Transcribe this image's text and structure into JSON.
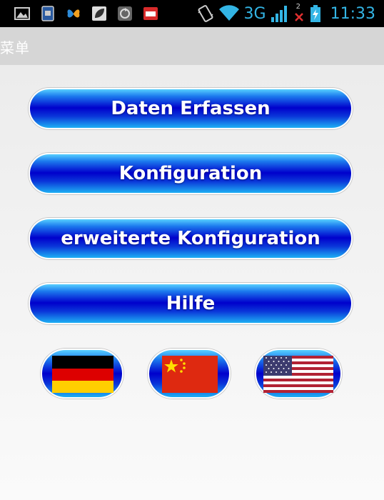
{
  "status_bar": {
    "network": "3G",
    "signal_badge": "2",
    "time": "11:33",
    "accent_color": "#33b5e5",
    "icons": [
      "gallery-icon",
      "sim-icon",
      "butterfly-icon",
      "leaf-icon",
      "backup-icon",
      "news-app-icon",
      "vibrate-icon",
      "wifi-icon",
      "signal-icon",
      "no-data-icon",
      "battery-charging-icon"
    ]
  },
  "app_bar": {
    "title": "菜单"
  },
  "menu": {
    "buttons": [
      {
        "label": "Daten Erfassen"
      },
      {
        "label": "Konfiguration"
      },
      {
        "label": "erweiterte Konfiguration"
      },
      {
        "label": "Hilfe"
      }
    ]
  },
  "languages": [
    {
      "flag": "germany-flag-icon"
    },
    {
      "flag": "china-flag-icon"
    },
    {
      "flag": "usa-flag-icon"
    }
  ],
  "colors": {
    "button_blue": "#0000cc",
    "button_highlight": "#1eb0f4"
  }
}
